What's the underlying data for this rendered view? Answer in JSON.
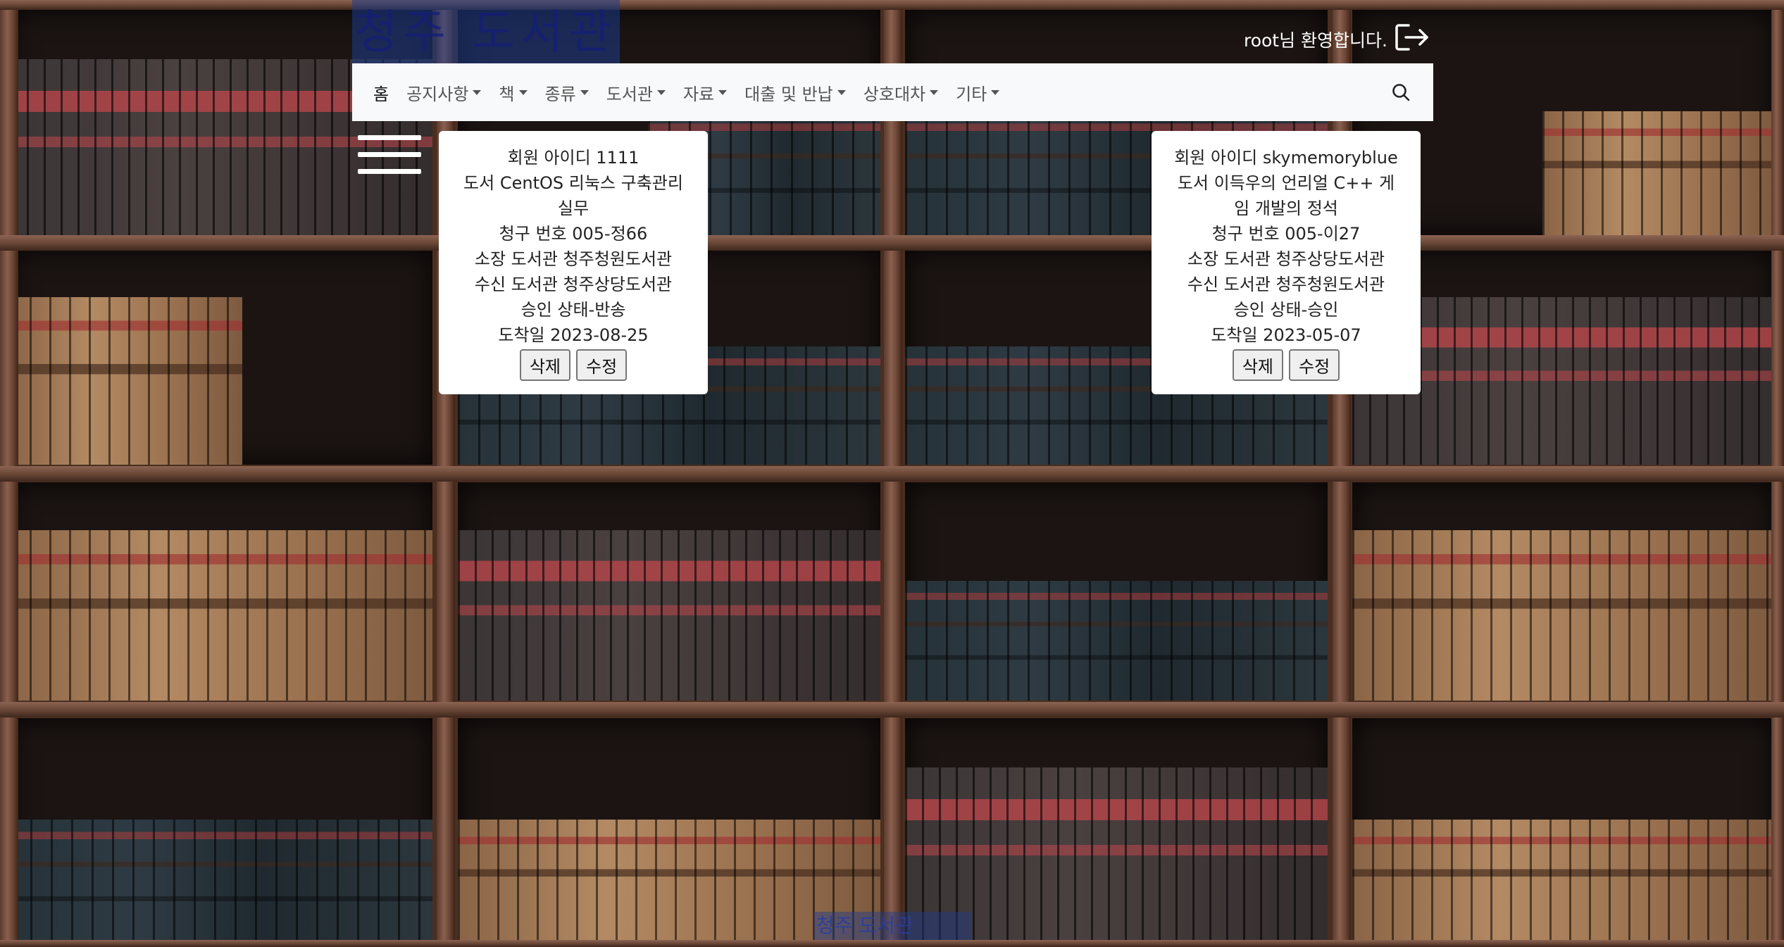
{
  "header": {
    "logo_text": "청주 도서관",
    "welcome_text": "root님 환영합니다."
  },
  "nav": {
    "items": [
      {
        "label": "홈",
        "dropdown": false
      },
      {
        "label": "공지사항",
        "dropdown": true
      },
      {
        "label": "책",
        "dropdown": true
      },
      {
        "label": "종류",
        "dropdown": true
      },
      {
        "label": "도서관",
        "dropdown": true
      },
      {
        "label": "자료",
        "dropdown": true
      },
      {
        "label": "대출 및 반납",
        "dropdown": true
      },
      {
        "label": "상호대차",
        "dropdown": true
      },
      {
        "label": "기타",
        "dropdown": true
      }
    ]
  },
  "cards": [
    {
      "member": "회원 아이디 1111",
      "book_line1": "도서 CentOS 리눅스 구축관리",
      "book_line2": "실무",
      "call_number": "청구 번호 005-정66",
      "owner_library": "소장 도서관 청주청원도서관",
      "receive_library": "수신 도서관 청주상당도서관",
      "status": "승인 상태-반송",
      "arrival": "도착일 2023-08-25",
      "delete_label": "삭제",
      "edit_label": "수정"
    },
    {
      "member": "회원 아이디 skymemoryblue",
      "book_line1": "도서 이득우의 언리얼 C++ 게",
      "book_line2": "임 개발의 정석",
      "call_number": "청구 번호 005-이27",
      "owner_library": "소장 도서관 청주상당도서관",
      "receive_library": "수신 도서관 청주청원도서관",
      "status": "승인 상태-승인",
      "arrival": "도착일 2023-05-07",
      "delete_label": "삭제",
      "edit_label": "수정"
    }
  ],
  "footer": {
    "text": "청주 도서관"
  },
  "icons": {
    "logout": "logout-icon",
    "search": "search-icon",
    "menu": "hamburger-menu-icon"
  }
}
